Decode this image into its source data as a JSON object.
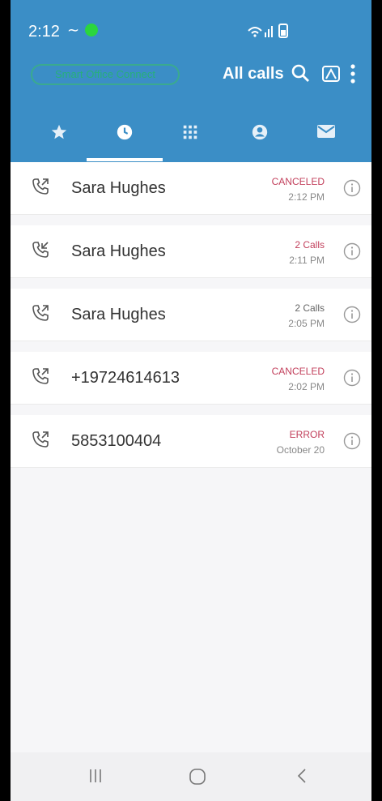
{
  "statusbar": {
    "time": "2:12",
    "trail_glyph": "∼"
  },
  "header": {
    "brand_text": "Smart Office Connect",
    "title": "All calls"
  },
  "tabs": [
    {
      "icon": "star-icon"
    },
    {
      "icon": "clock-icon",
      "active": true
    },
    {
      "icon": "dialpad-icon"
    },
    {
      "icon": "contact-icon"
    },
    {
      "icon": "mail-icon"
    }
  ],
  "calls": [
    {
      "name": "Sara Hughes",
      "status": "CANCELED",
      "time": "2:12 PM",
      "direction": "outgoing",
      "status_color": "#c2405c"
    },
    {
      "name": "Sara Hughes",
      "status": "2 Calls",
      "time": "2:11 PM",
      "direction": "incoming",
      "status_color": "#c2405c"
    },
    {
      "name": "Sara Hughes",
      "status": "2 Calls",
      "time": "2:05 PM",
      "direction": "outgoing",
      "status_color": "#666666"
    },
    {
      "name": "+19724614613",
      "status": "CANCELED",
      "time": "2:02 PM",
      "direction": "outgoing",
      "status_color": "#c2405c"
    },
    {
      "name": "5853100404",
      "status": "ERROR",
      "time": "October 20",
      "direction": "outgoing",
      "status_color": "#c2405c"
    }
  ],
  "colors": {
    "header_bg": "#3b8ec6",
    "accent_red": "#c2405c",
    "brand_green": "#27b07a"
  }
}
